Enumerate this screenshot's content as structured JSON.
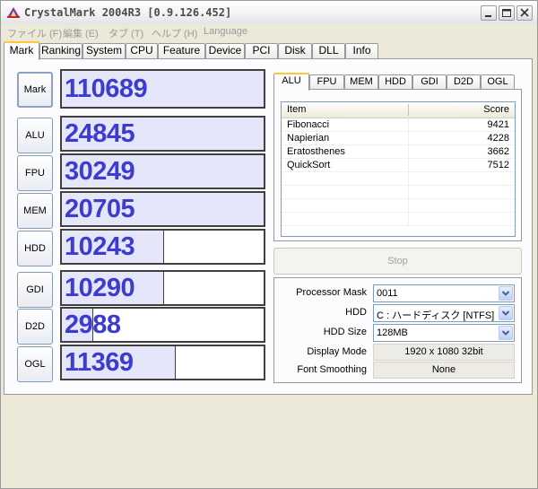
{
  "window": {
    "title": "CrystalMark 2004R3 [0.9.126.452]",
    "icon": "crystalmark-app-icon",
    "controls": [
      "minimize-icon",
      "maximize-icon",
      "close-icon"
    ]
  },
  "menu": [
    {
      "label": "ファイル (F)"
    },
    {
      "label": "編集 (E)"
    },
    {
      "label": "タブ (T)"
    },
    {
      "label": "ヘルプ (H)"
    },
    {
      "label": "Language"
    }
  ],
  "tabs": [
    {
      "label": "Mark",
      "active": true
    },
    {
      "label": "Ranking"
    },
    {
      "label": "System"
    },
    {
      "label": "CPU"
    },
    {
      "label": "Feature"
    },
    {
      "label": "Device"
    },
    {
      "label": "PCI"
    },
    {
      "label": "Disk"
    },
    {
      "label": "DLL"
    },
    {
      "label": "Info"
    }
  ],
  "scores": [
    {
      "label": "Mark",
      "value": "110689",
      "fill_fraction": 1.0
    },
    {
      "label": "ALU",
      "value": "24845",
      "fill_fraction": 1.0
    },
    {
      "label": "FPU",
      "value": "30249",
      "fill_fraction": 1.0
    },
    {
      "label": "MEM",
      "value": "20705",
      "fill_fraction": 1.0
    },
    {
      "label": "HDD",
      "value": "10243",
      "fill_fraction": 0.5
    },
    {
      "label": "GDI",
      "value": "10290",
      "fill_fraction": 0.5
    },
    {
      "label": "D2D",
      "value": "2988",
      "fill_fraction": 0.15
    },
    {
      "label": "OGL",
      "value": "11369",
      "fill_fraction": 0.56
    }
  ],
  "sub_tabs": [
    {
      "label": "ALU",
      "active": true
    },
    {
      "label": "FPU"
    },
    {
      "label": "MEM"
    },
    {
      "label": "HDD"
    },
    {
      "label": "GDI"
    },
    {
      "label": "D2D"
    },
    {
      "label": "OGL"
    }
  ],
  "results": {
    "columns": [
      "Item",
      "Score"
    ],
    "rows": [
      {
        "item": "Fibonacci",
        "score": "9421"
      },
      {
        "item": "Napierian",
        "score": "4228"
      },
      {
        "item": "Eratosthenes",
        "score": "3662"
      },
      {
        "item": "QuickSort",
        "score": "7512"
      }
    ]
  },
  "stop_button": "Stop",
  "options": {
    "processor_mask": {
      "label": "Processor Mask",
      "value": "0011"
    },
    "hdd": {
      "label": "HDD",
      "value": "C : ハードディスク [NTFS]"
    },
    "hdd_size": {
      "label": "HDD Size",
      "value": "128MB"
    },
    "display_mode": {
      "label": "Display Mode",
      "value": "1920 x 1080 32bit"
    },
    "font_smoothing": {
      "label": "Font Smoothing",
      "value": "None"
    }
  },
  "colors": {
    "score_text": "#3c3cd0",
    "score_fill": "#e6e6fa",
    "active_tab_accent": "#ffc83c"
  }
}
